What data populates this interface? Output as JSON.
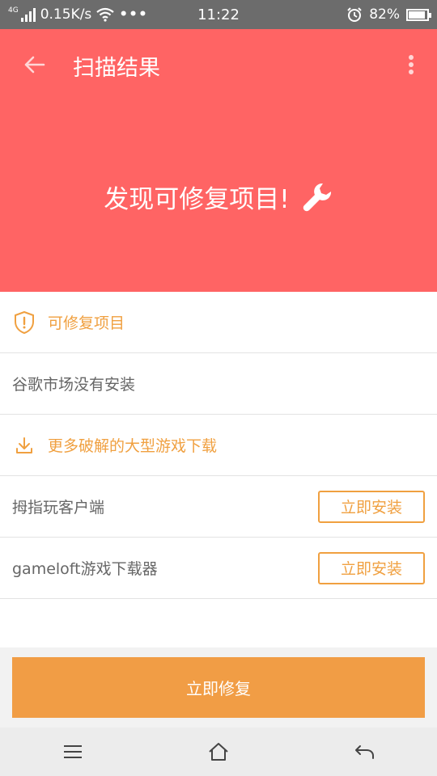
{
  "status_bar": {
    "network": "4G",
    "speed": "0.15K/s",
    "more": "•••",
    "time": "11:22",
    "battery": "82%",
    "battery_level": 0.82
  },
  "header": {
    "title": "扫描结果",
    "hero_text": "发现可修复项目!",
    "icons": {
      "back": "back-arrow-icon",
      "more": "more-vertical-icon",
      "hero": "wrench-icon"
    }
  },
  "list": {
    "repair_section": {
      "label": "可修复项目",
      "icon": "shield-alert-icon"
    },
    "issue": "谷歌市场没有安装",
    "download_section": {
      "label": "更多破解的大型游戏下载",
      "icon": "download-icon"
    },
    "apps": [
      {
        "name": "拇指玩客户端",
        "button": "立即安装"
      },
      {
        "name": "gameloft游戏下载器",
        "button": "立即安装"
      }
    ]
  },
  "repair_button": "立即修复",
  "colors": {
    "header": "#ff6464",
    "accent": "#f0a040",
    "repair_button": "#f19d45"
  }
}
